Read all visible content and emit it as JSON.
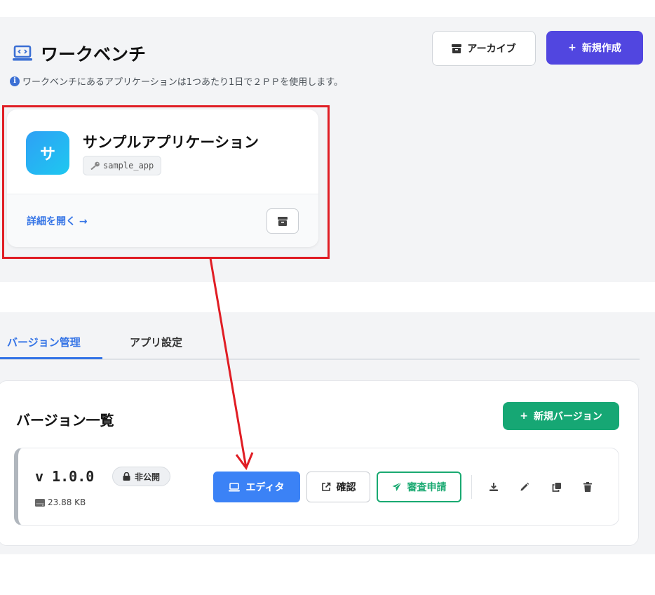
{
  "header": {
    "title": "ワークベンチ",
    "info": "ワークベンチにあるアプリケーションは1つあたり1日で２ＰＰを使用します。",
    "archive_label": "アーカイブ",
    "new_label": "新規作成",
    "new_prefix": "+"
  },
  "app_card": {
    "avatar_letter": "サ",
    "name": "サンプルアプリケーション",
    "key": "sample_app",
    "open_label": "詳細を開く →"
  },
  "tabs": [
    {
      "label": "バージョン管理",
      "active": true
    },
    {
      "label": "アプリ設定",
      "active": false
    }
  ],
  "versions": {
    "title": "バージョン一覧",
    "new_version_label": "新規バージョン",
    "new_prefix": "+",
    "rows": [
      {
        "version": "v 1.0.0",
        "visibility": "非公開",
        "size": "23.88 KB",
        "editor_label": "エディタ",
        "check_label": "確認",
        "review_label": "審査申請"
      }
    ]
  },
  "colors": {
    "primary": "#5146e0",
    "accent_blue": "#3b82f6",
    "accent_green": "#16a774",
    "annotation_red": "#e01d24"
  },
  "icons": [
    "laptop-code-icon",
    "info-icon",
    "archive-icon",
    "plus-icon",
    "key-icon",
    "lock-icon",
    "hdd-icon",
    "external-link-icon",
    "paper-plane-icon",
    "download-icon",
    "pencil-icon",
    "copy-icon",
    "trash-icon"
  ]
}
